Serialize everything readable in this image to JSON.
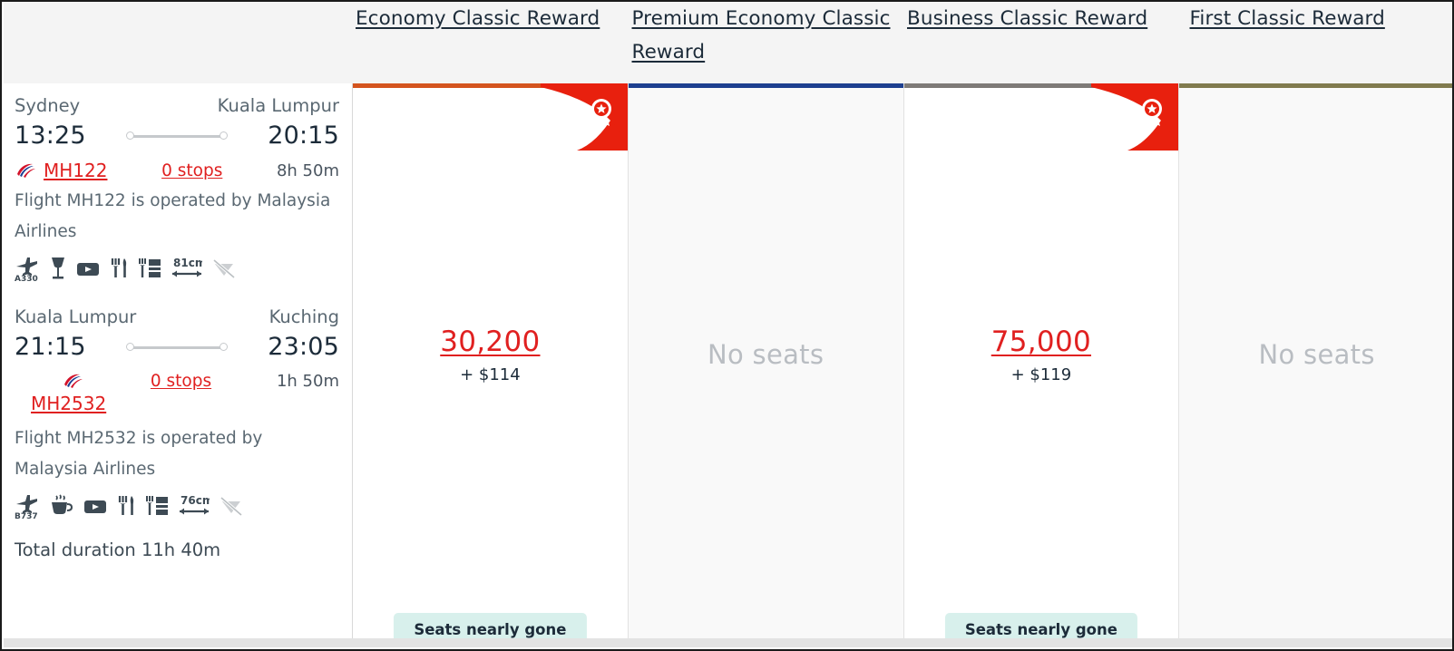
{
  "columns": [
    {
      "id": "economy",
      "title": "Economy Classic Reward",
      "accent_color": "#d4541e",
      "available": true,
      "points": "30,200",
      "cash": "+ $114",
      "badge": "Seats nearly gone",
      "ribbon_icon": "award-ribbon-icon",
      "has_ribbon": true
    },
    {
      "id": "premium-economy",
      "title": "Premium Economy Classic Reward",
      "accent_color": "#1d3f8f",
      "available": false,
      "unavailable_label": "No seats",
      "has_ribbon": false
    },
    {
      "id": "business",
      "title": "Business Classic Reward",
      "accent_color": "#7e7a77",
      "available": true,
      "points": "75,000",
      "cash": "+ $119",
      "badge": "Seats nearly gone",
      "ribbon_icon": "award-ribbon-icon",
      "has_ribbon": true
    },
    {
      "id": "first",
      "title": "First Classic Reward",
      "accent_color": "#807a4e",
      "available": false,
      "unavailable_label": "No seats",
      "has_ribbon": false
    }
  ],
  "itinerary": {
    "segments": [
      {
        "origin": "Sydney",
        "destination": "Kuala Lumpur",
        "depart_time": "13:25",
        "arrive_time": "20:15",
        "flight_number": "MH122",
        "stops": "0 stops",
        "duration": "8h 50m",
        "operated_by": "Flight MH122 is operated by Malaysia Airlines",
        "amenities": [
          {
            "name": "aircraft-icon",
            "label": "A330"
          },
          {
            "name": "wine-glass-icon",
            "label": ""
          },
          {
            "name": "video-screen-icon",
            "label": ""
          },
          {
            "name": "meal-cutlery-icon",
            "label": ""
          },
          {
            "name": "meal-service-icon",
            "label": ""
          },
          {
            "name": "seat-pitch-icon",
            "label": "81cm"
          },
          {
            "name": "wifi-unavailable-icon",
            "label": ""
          }
        ]
      },
      {
        "origin": "Kuala Lumpur",
        "destination": "Kuching",
        "depart_time": "21:15",
        "arrive_time": "23:05",
        "flight_number": "MH2532",
        "stops": "0 stops",
        "duration": "1h 50m",
        "operated_by": "Flight MH2532 is operated by Malaysia Airlines",
        "amenities": [
          {
            "name": "aircraft-icon",
            "label": "B737"
          },
          {
            "name": "coffee-cup-icon",
            "label": ""
          },
          {
            "name": "video-screen-icon",
            "label": ""
          },
          {
            "name": "meal-cutlery-icon",
            "label": ""
          },
          {
            "name": "meal-service-icon",
            "label": ""
          },
          {
            "name": "seat-pitch-icon",
            "label": "76cm"
          },
          {
            "name": "wifi-unavailable-icon",
            "label": ""
          }
        ]
      }
    ],
    "total_duration": "Total duration 11h 40m"
  }
}
